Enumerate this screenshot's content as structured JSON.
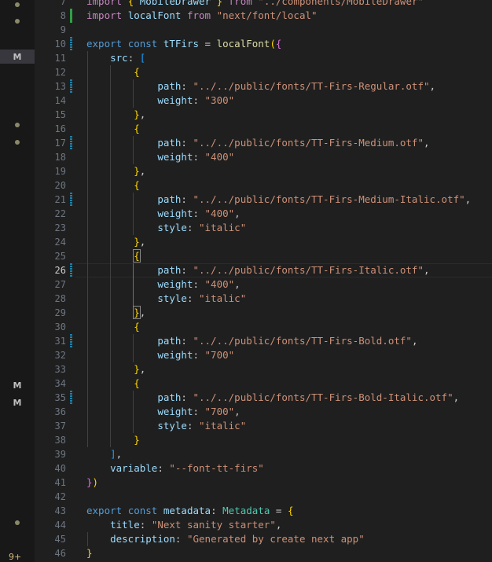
{
  "editor": {
    "current_line": 26,
    "line_numbers": [
      "7",
      "8",
      "9",
      "10",
      "11",
      "12",
      "13",
      "14",
      "15",
      "16",
      "17",
      "18",
      "19",
      "20",
      "21",
      "22",
      "23",
      "24",
      "25",
      "26",
      "27",
      "28",
      "29",
      "30",
      "31",
      "32",
      "33",
      "34",
      "35",
      "36",
      "37",
      "38",
      "39",
      "40",
      "41",
      "42",
      "43",
      "44",
      "45",
      "46"
    ],
    "code": {
      "l7": {
        "t1": "import",
        "t2": "{",
        "t3": "MobileDrawer",
        "t4": "}",
        "t5": "from",
        "t6": "\"../components/MobileDrawer\""
      },
      "l8": {
        "t1": "import",
        "t2": "localFont",
        "t3": "from",
        "t4": "\"next/font/local\""
      },
      "l10": {
        "t1": "export",
        "t2": "const",
        "t3": "tTFirs",
        "t4": "=",
        "t5": "localFont",
        "t6": "(",
        "t7": "{"
      },
      "l11": {
        "t1": "src",
        "t2": ":",
        "t3": "["
      },
      "l12": {
        "t1": "{"
      },
      "l13": {
        "t1": "path",
        "t2": ":",
        "t3": "\"../../public/fonts/TT-Firs-Regular.otf\"",
        "t4": ","
      },
      "l14": {
        "t1": "weight",
        "t2": ":",
        "t3": "\"300\""
      },
      "l15": {
        "t1": "}",
        "t2": ","
      },
      "l16": {
        "t1": "{"
      },
      "l17": {
        "t1": "path",
        "t2": ":",
        "t3": "\"../../public/fonts/TT-Firs-Medium.otf\"",
        "t4": ","
      },
      "l18": {
        "t1": "weight",
        "t2": ":",
        "t3": "\"400\""
      },
      "l19": {
        "t1": "}",
        "t2": ","
      },
      "l20": {
        "t1": "{"
      },
      "l21": {
        "t1": "path",
        "t2": ":",
        "t3": "\"../../public/fonts/TT-Firs-Medium-Italic.otf\"",
        "t4": ","
      },
      "l22": {
        "t1": "weight",
        "t2": ":",
        "t3": "\"400\"",
        "t4": ","
      },
      "l23": {
        "t1": "style",
        "t2": ":",
        "t3": "\"italic\""
      },
      "l24": {
        "t1": "}",
        "t2": ","
      },
      "l25": {
        "t1": "{"
      },
      "l26": {
        "t1": "path",
        "t2": ":",
        "t3": "\"../../public/fonts/TT-Firs-Italic.otf\"",
        "t4": ","
      },
      "l27": {
        "t1": "weight",
        "t2": ":",
        "t3": "\"400\"",
        "t4": ","
      },
      "l28": {
        "t1": "style",
        "t2": ":",
        "t3": "\"italic\""
      },
      "l29": {
        "t1": "}",
        "t2": ","
      },
      "l30": {
        "t1": "{"
      },
      "l31": {
        "t1": "path",
        "t2": ":",
        "t3": "\"../../public/fonts/TT-Firs-Bold.otf\"",
        "t4": ","
      },
      "l32": {
        "t1": "weight",
        "t2": ":",
        "t3": "\"700\""
      },
      "l33": {
        "t1": "}",
        "t2": ","
      },
      "l34": {
        "t1": "{"
      },
      "l35": {
        "t1": "path",
        "t2": ":",
        "t3": "\"../../public/fonts/TT-Firs-Bold-Italic.otf\"",
        "t4": ","
      },
      "l36": {
        "t1": "weight",
        "t2": ":",
        "t3": "\"700\"",
        "t4": ","
      },
      "l37": {
        "t1": "style",
        "t2": ":",
        "t3": "\"italic\""
      },
      "l38": {
        "t1": "}"
      },
      "l39": {
        "t1": "]",
        "t2": ","
      },
      "l40": {
        "t1": "variable",
        "t2": ":",
        "t3": "\"--font-tt-firs\""
      },
      "l41": {
        "t1": "}",
        "t2": ")"
      },
      "l43": {
        "t1": "export",
        "t2": "const",
        "t3": "metadata",
        "t4": ":",
        "t5": "Metadata",
        "t6": "=",
        "t7": "{"
      },
      "l44": {
        "t1": "title",
        "t2": ":",
        "t3": "\"Next sanity starter\"",
        "t4": ","
      },
      "l45": {
        "t1": "description",
        "t2": ":",
        "t3": "\"Generated by create next app\""
      },
      "l46": {
        "t1": "}"
      }
    }
  },
  "sidebar": {
    "markers": [
      "M",
      "M",
      "M"
    ],
    "badge": "9+"
  },
  "colors": {
    "background": "#1f1f1f",
    "keyword": "#c586c0",
    "string": "#ce9178",
    "property": "#9cdcfe",
    "function": "#dcdcaa",
    "type": "#4ec9b0",
    "bracket_gold": "#ffd700",
    "diff_added": "#2ea043",
    "diff_modified": "#1b81a8"
  }
}
